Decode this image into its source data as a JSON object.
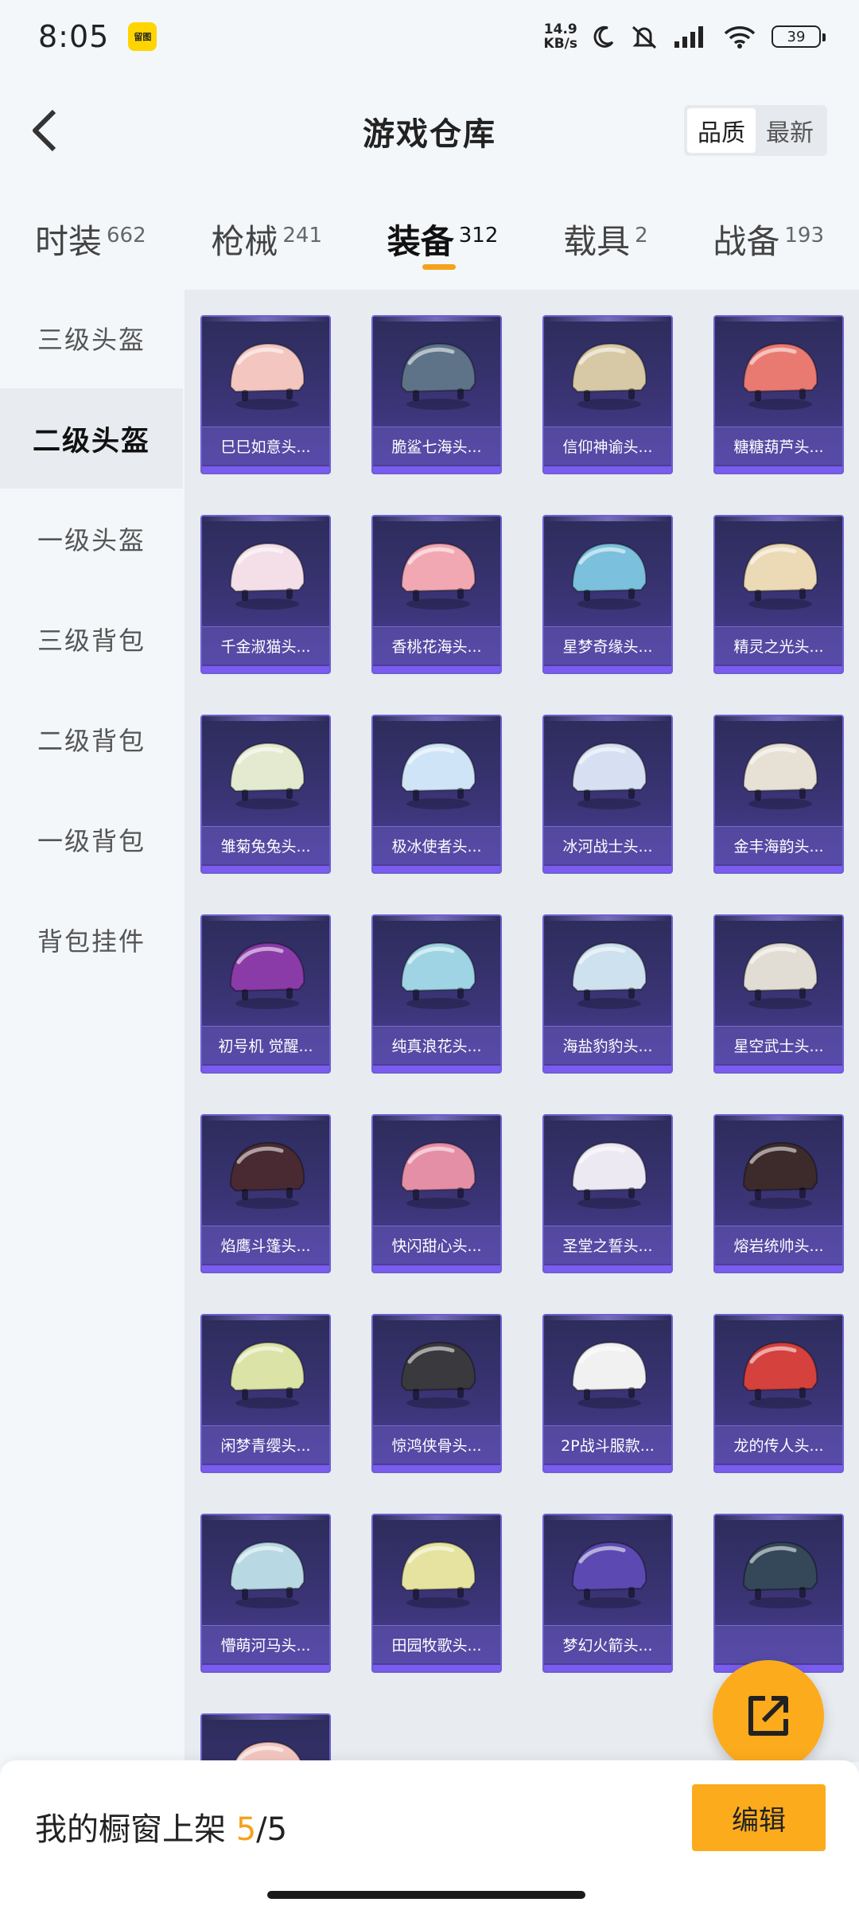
{
  "status_bar": {
    "time": "8:05",
    "app_badge": "留图",
    "net_speed_value": "14.9",
    "net_speed_unit": "KB/s",
    "battery": "39"
  },
  "header": {
    "title": "游戏仓库",
    "sort_options": [
      "品质",
      "最新"
    ],
    "sort_selected": "品质"
  },
  "tabs": [
    {
      "label": "时装",
      "count": "662"
    },
    {
      "label": "枪械",
      "count": "241"
    },
    {
      "label": "装备",
      "count": "312",
      "active": true
    },
    {
      "label": "载具",
      "count": "2"
    },
    {
      "label": "战备",
      "count": "193"
    }
  ],
  "sidebar": {
    "items": [
      {
        "label": "三级头盔"
      },
      {
        "label": "二级头盔",
        "active": true
      },
      {
        "label": "一级头盔"
      },
      {
        "label": "三级背包"
      },
      {
        "label": "二级背包"
      },
      {
        "label": "一级背包"
      },
      {
        "label": "背包挂件"
      }
    ]
  },
  "items": [
    {
      "label": "巳巳如意头...",
      "icon": "pink-ribbon-helmet-icon",
      "color": "#f3c7c0"
    },
    {
      "label": "脆鲨七海头...",
      "icon": "shark-helmet-icon",
      "color": "#5e7388"
    },
    {
      "label": "信仰神谕头...",
      "icon": "winged-gold-helmet-icon",
      "color": "#d8c9a6"
    },
    {
      "label": "糖糖葫芦头...",
      "icon": "red-candy-helmet-icon",
      "color": "#e97a72"
    },
    {
      "label": "千金淑猫头...",
      "icon": "cat-ear-helmet-icon",
      "color": "#f4dfe8"
    },
    {
      "label": "香桃花海头...",
      "icon": "peach-helmet-icon",
      "color": "#f1a8b3"
    },
    {
      "label": "星梦奇缘头...",
      "icon": "starry-blue-helmet-icon",
      "color": "#7bc0dc"
    },
    {
      "label": "精灵之光头...",
      "icon": "pearl-helmet-icon",
      "color": "#ecd9b6"
    },
    {
      "label": "雏菊兔兔头...",
      "icon": "daisy-helmet-icon",
      "color": "#e4ead0"
    },
    {
      "label": "极冰使者头...",
      "icon": "ice-helmet-icon",
      "color": "#cfe4f6"
    },
    {
      "label": "冰河战士头...",
      "icon": "blue-white-helmet-icon",
      "color": "#d6e0f2"
    },
    {
      "label": "金丰海韵头...",
      "icon": "gold-wave-helmet-icon",
      "color": "#e7e1d5"
    },
    {
      "label": "初号机 觉醒...",
      "icon": "purple-mech-helmet-icon",
      "color": "#8b3ba8"
    },
    {
      "label": "纯真浪花头...",
      "icon": "wave-teal-helmet-icon",
      "color": "#9ed4e3"
    },
    {
      "label": "海盐豹豹头...",
      "icon": "goggle-helmet-icon",
      "color": "#cde1ef"
    },
    {
      "label": "星空武士头...",
      "icon": "samurai-helmet-icon",
      "color": "#e2ddd4"
    },
    {
      "label": "焰鹰斗篷头...",
      "icon": "dark-red-helmet-icon",
      "color": "#4a2a32"
    },
    {
      "label": "快闪甜心头...",
      "icon": "pink-black-helmet-icon",
      "color": "#e58fa6"
    },
    {
      "label": "圣堂之誓头...",
      "icon": "holy-wing-helmet-icon",
      "color": "#ede9f3"
    },
    {
      "label": "熔岩统帅头...",
      "icon": "lava-helmet-icon",
      "color": "#3d2b2b"
    },
    {
      "label": "闲梦青缨头...",
      "icon": "green-tassel-helmet-icon",
      "color": "#dbe3a6"
    },
    {
      "label": "惊鸿侠骨头...",
      "icon": "black-ninja-helmet-icon",
      "color": "#3a3a3e"
    },
    {
      "label": "2P战斗服款...",
      "icon": "white-suit-helmet-icon",
      "color": "#f1f1f1"
    },
    {
      "label": "龙的传人头...",
      "icon": "dragon-red-helmet-icon",
      "color": "#d5413d"
    },
    {
      "label": "懵萌河马头...",
      "icon": "hippo-helmet-icon",
      "color": "#b8d8e4"
    },
    {
      "label": "田园牧歌头...",
      "icon": "pastoral-helmet-icon",
      "color": "#e6e3a0"
    },
    {
      "label": "梦幻火箭头...",
      "icon": "rocket-helmet-icon",
      "color": "#5c4ab2"
    },
    {
      "label": "",
      "icon": "teal-black-helmet-icon",
      "color": "#34485a"
    },
    {
      "label": "",
      "icon": "pink-ribbon-helmet-icon",
      "color": "#f3c7c0"
    }
  ],
  "bottom_bar": {
    "showcase_label": "我的橱窗上架 ",
    "showcase_current": "5",
    "showcase_total": "/5",
    "edit_label": "编辑"
  }
}
